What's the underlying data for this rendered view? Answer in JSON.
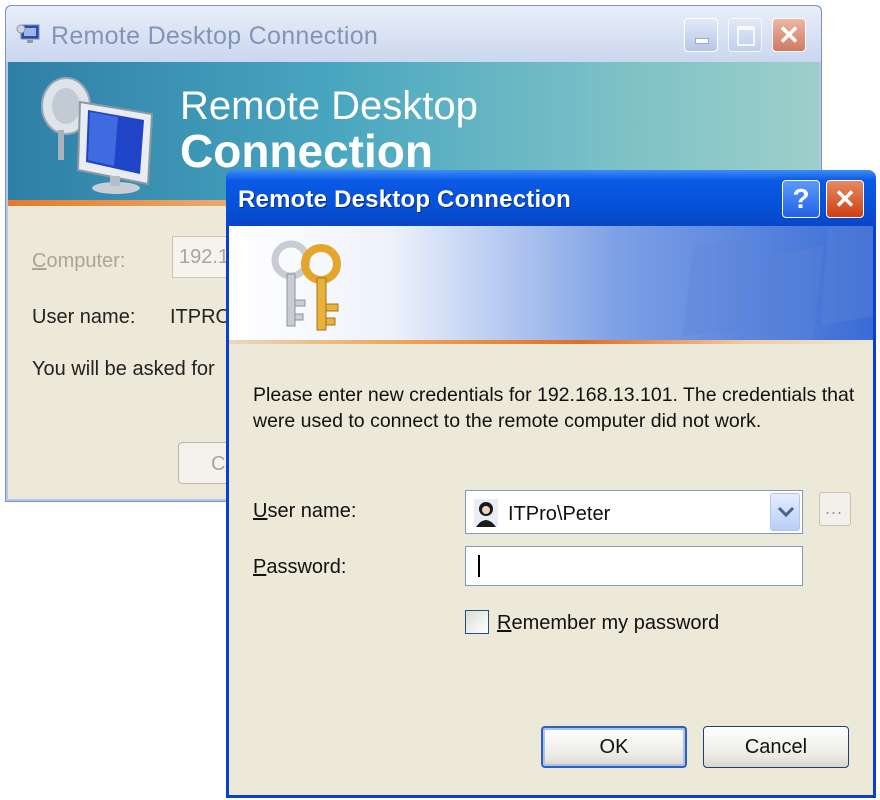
{
  "back_window": {
    "title": "Remote Desktop Connection",
    "banner_line1": "Remote Desktop",
    "banner_line2": "Connection",
    "computer_label_u": "C",
    "computer_label_rest": "omputer:",
    "computer_value": "192.1",
    "username_label": "User name:",
    "username_value": "ITPRO",
    "asked_text": "You will be asked for",
    "button_partial": "C"
  },
  "dialog": {
    "title": "Remote Desktop Connection",
    "help_glyph": "?",
    "message": "Please enter new credentials for 192.168.13.101. The credentials that were used to connect to the remote computer did not work.",
    "username_label_u": "U",
    "username_label_rest": "ser name:",
    "username_value": "ITPro\\Peter",
    "browse_label": "...",
    "password_label_u": "P",
    "password_label_rest": "assword:",
    "password_value": "",
    "remember_label_u": "R",
    "remember_label_rest": "emember my password",
    "remember_checked": false,
    "ok_label": "OK",
    "cancel_label": "Cancel"
  },
  "colors": {
    "titlebar_active": "#0652d8",
    "dialog_face": "#ece9d8",
    "accent_orange": "#e46d1f"
  }
}
